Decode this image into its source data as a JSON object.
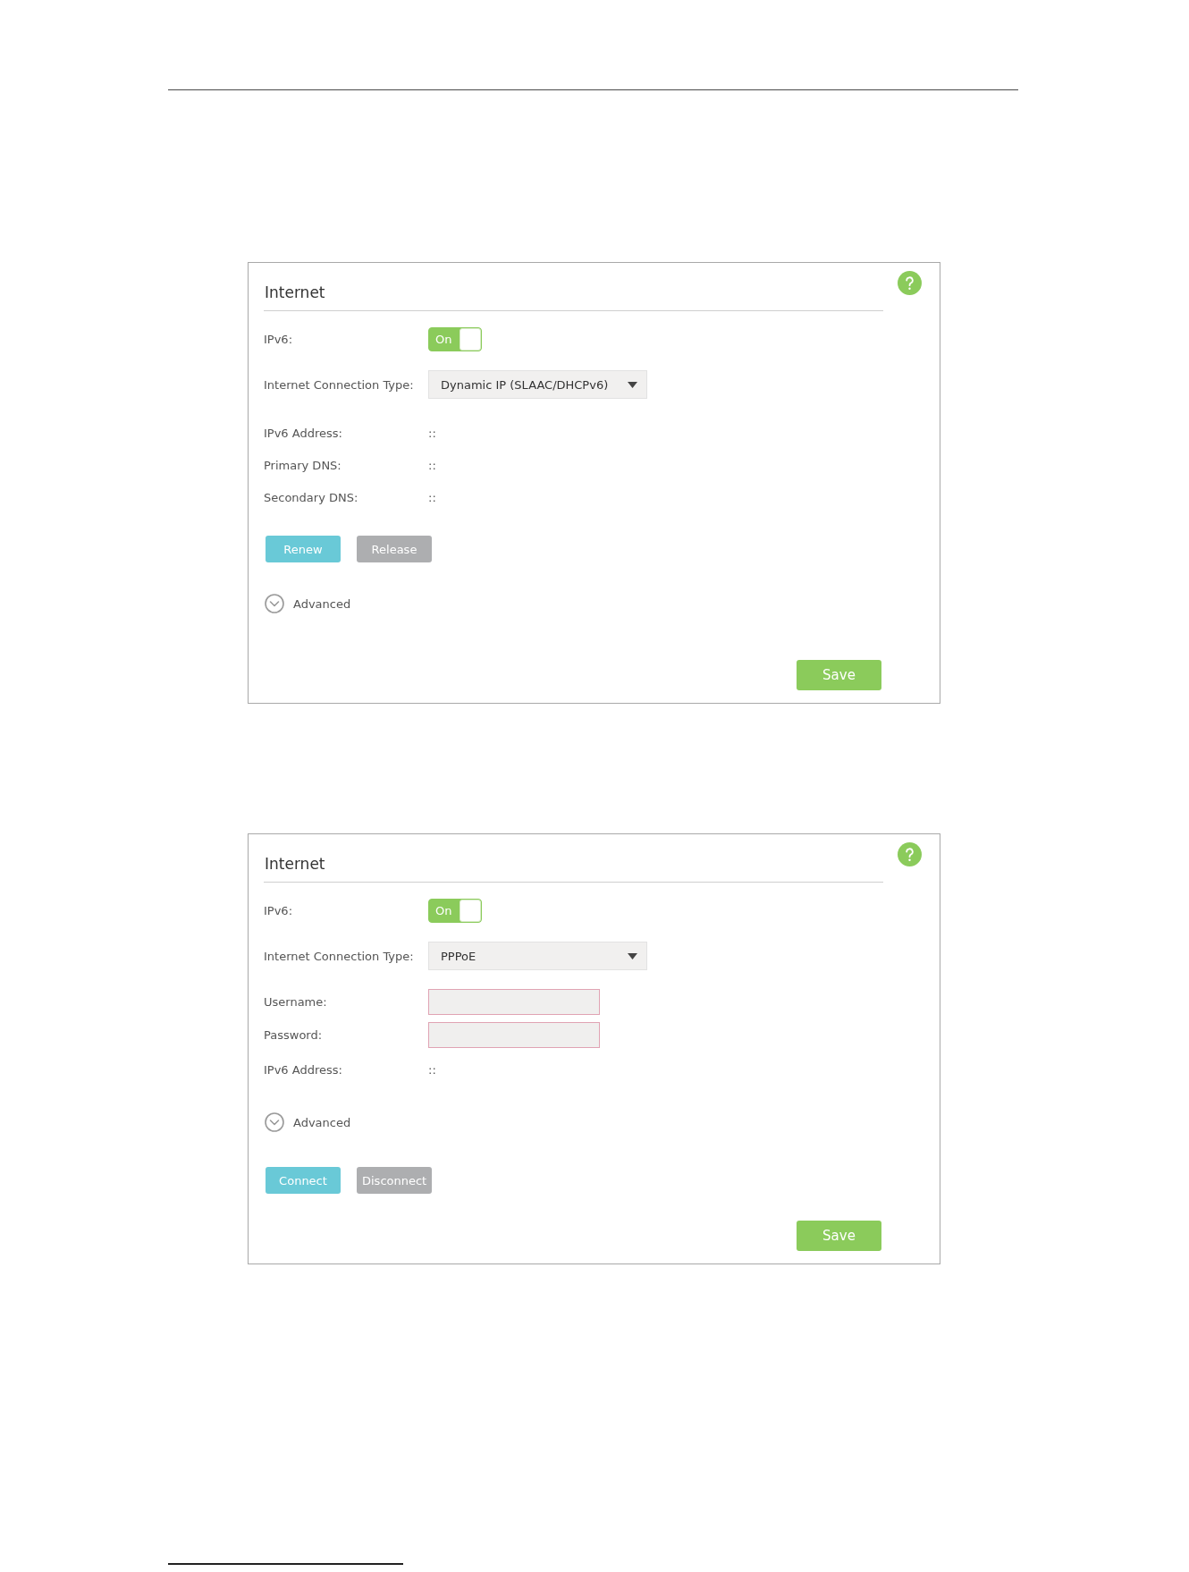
{
  "panels": [
    {
      "title": "Internet",
      "rows": [
        {
          "kind": "toggle",
          "label": "IPv6:",
          "text": "On",
          "on": true
        },
        {
          "kind": "select",
          "label": "Internet Connection Type:",
          "value": "Dynamic IP (SLAAC/DHCPv6)"
        },
        {
          "kind": "info",
          "label": "IPv6 Address:",
          "value": "::"
        },
        {
          "kind": "info",
          "label": "Primary DNS:",
          "value": "::"
        },
        {
          "kind": "info",
          "label": "Secondary DNS:",
          "value": "::"
        },
        {
          "kind": "buttons",
          "buttons": [
            {
              "label": "Renew",
              "kind": "primary"
            },
            {
              "label": "Release",
              "kind": "secondary"
            }
          ]
        },
        {
          "kind": "expander",
          "label": "Advanced",
          "expanded": false
        }
      ],
      "save": "Save"
    },
    {
      "title": "Internet",
      "rows": [
        {
          "kind": "toggle",
          "label": "IPv6:",
          "text": "On",
          "on": true
        },
        {
          "kind": "select",
          "label": "Internet Connection Type:",
          "value": "PPPoE"
        },
        {
          "kind": "input",
          "label": "Username:"
        },
        {
          "kind": "input",
          "label": "Password:"
        },
        {
          "kind": "info",
          "label": "IPv6 Address:",
          "value": "::"
        },
        {
          "kind": "expander",
          "label": "Advanced",
          "expanded": false
        },
        {
          "kind": "buttons",
          "buttons": [
            {
              "label": "Connect",
              "kind": "primary"
            },
            {
              "label": "Disconnect",
              "kind": "secondary"
            }
          ]
        }
      ],
      "save": "Save"
    }
  ]
}
